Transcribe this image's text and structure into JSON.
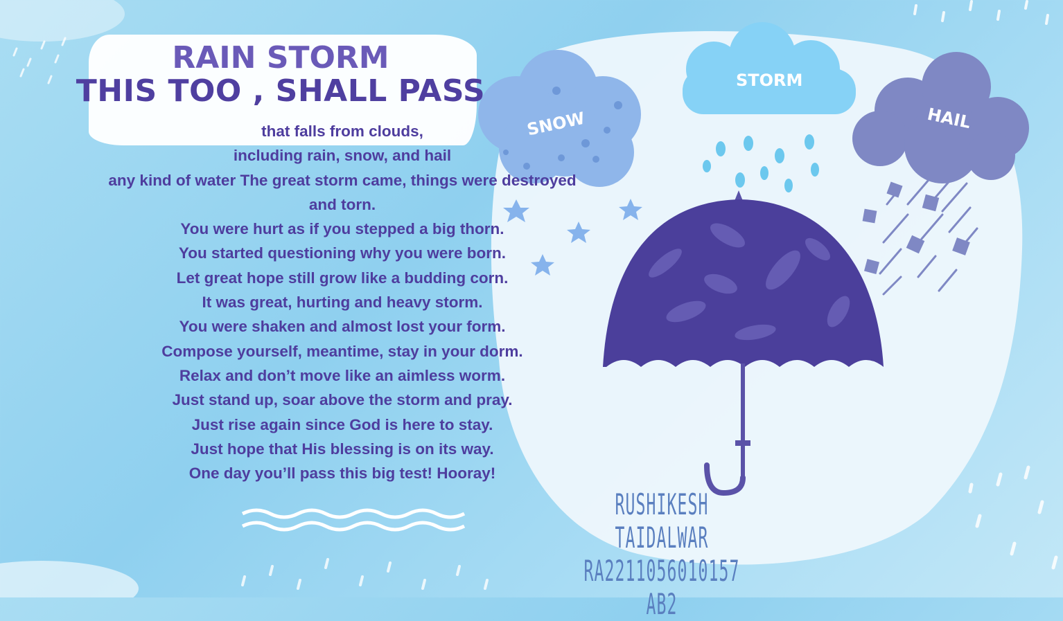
{
  "title": {
    "line1": "RAIN STORM",
    "line2": "THIS TOO , SHALL PASS"
  },
  "poem": {
    "lines": [
      "that falls from clouds,",
      "including rain, snow, and hail",
      "any kind of water The great storm came, things were destroyed",
      "and torn.",
      "You were hurt as if you stepped a big thorn.",
      "You started questioning why you were born.",
      "Let great hope still grow like a budding corn.",
      "It was great, hurting and heavy storm.",
      "You were shaken and almost lost your form.",
      "Compose yourself, meantime, stay in your dorm.",
      "Relax and don’t move like an aimless worm.",
      "Just stand up, soar above the storm and pray.",
      "Just rise again since God is here to stay.",
      "Just hope that His blessing is on its way.",
      "One day you’ll pass this big test! Hooray!"
    ]
  },
  "clouds": {
    "snow": "SNOW",
    "storm": "STORM",
    "hail": "HAIL"
  },
  "signature": {
    "name": "RUSHIKESH TAIDALWAR",
    "id": "RA2211056010157",
    "section": "AB2"
  },
  "icons": [
    "snow-cloud-icon",
    "storm-cloud-icon",
    "hail-cloud-icon",
    "umbrella-icon",
    "snowflake-icon",
    "raindrop-icon",
    "hail-cube-icon",
    "wave-icon"
  ],
  "colors": {
    "background": "#a9ddf3",
    "title": "#4f3fa0",
    "poem": "#4e3d9e",
    "umbrella": "#4b3f9b",
    "snow_cloud": "#8fb6ea",
    "storm_cloud": "#86d2f6",
    "hail_cloud": "#7f88c4",
    "signature": "#5a7fbf"
  }
}
